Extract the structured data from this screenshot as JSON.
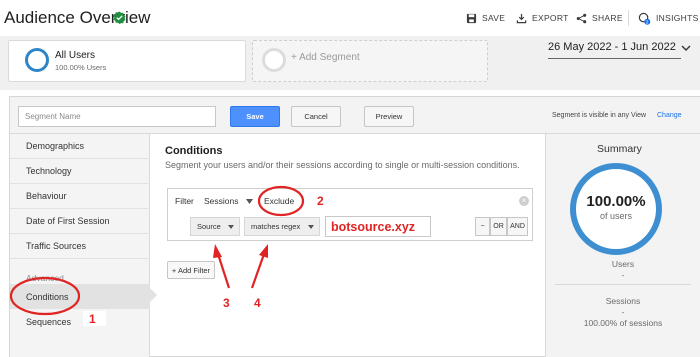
{
  "header": {
    "title": "Audience Overview",
    "actions": {
      "save": "SAVE",
      "export": "EXPORT",
      "share": "SHARE",
      "insights": "INSIGHTS",
      "insights_badge": "2"
    }
  },
  "segments": {
    "all_users": {
      "name": "All Users",
      "pct": "100.00% Users"
    },
    "add_segment": "+ Add Segment"
  },
  "date_range": "26 May 2022 - 1 Jun 2022",
  "editor": {
    "segment_name_placeholder": "Segment Name",
    "save": "Save",
    "cancel": "Cancel",
    "preview": "Preview",
    "visibility_text": "Segment is visible in any View",
    "change_link": "Change"
  },
  "nav": {
    "items": [
      "Demographics",
      "Technology",
      "Behaviour",
      "Date of First Session",
      "Traffic Sources"
    ],
    "advanced_heading": "Advanced",
    "advanced_items": [
      "Conditions",
      "Sequences"
    ]
  },
  "conditions": {
    "title": "Conditions",
    "subtitle": "Segment your users and/or their sessions according to single or multi-session conditions.",
    "filter_label": "Filter",
    "filter_scope": "Sessions",
    "filter_mode": "Exclude",
    "dimension": "Source",
    "operator": "matches regex",
    "value": "botsource.xyz",
    "logic": [
      "−",
      "OR",
      "AND"
    ],
    "add_filter": "+ Add Filter"
  },
  "summary": {
    "title": "Summary",
    "pct": "100.00%",
    "of_label": "of users",
    "users_label": "Users",
    "users_value": "-",
    "sessions_label": "Sessions",
    "sessions_value": "-",
    "sessions_pct": "100.00% of sessions"
  },
  "annotations": [
    "1",
    "2",
    "3",
    "4"
  ],
  "colors": {
    "accent": "#4d90fe",
    "annotation": "#e02424",
    "ring": "#3d8fd1"
  }
}
